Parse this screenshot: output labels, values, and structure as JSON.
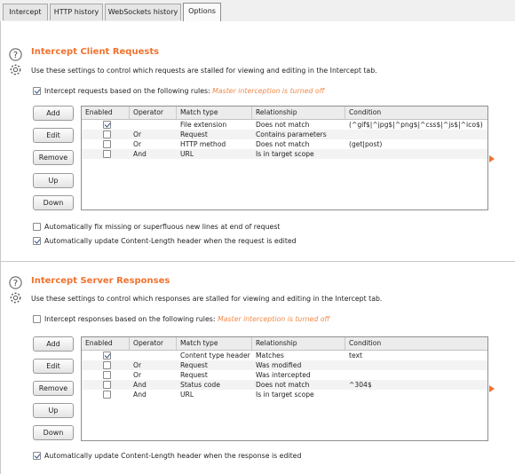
{
  "tabs": [
    {
      "label": "Intercept"
    },
    {
      "label": "HTTP history"
    },
    {
      "label": "WebSockets history"
    },
    {
      "label": "Options"
    }
  ],
  "client": {
    "title": "Intercept Client Requests",
    "description": "Use these settings to control which requests are stalled for viewing and editing in the Intercept tab.",
    "rules_checkbox_label": "Intercept requests based on the following rules:",
    "rules_checked": true,
    "warning": "Master interception is turned off",
    "buttons": {
      "add": "Add",
      "edit": "Edit",
      "remove": "Remove",
      "up": "Up",
      "down": "Down"
    },
    "columns": {
      "enabled": "Enabled",
      "operator": "Operator",
      "match_type": "Match type",
      "relationship": "Relationship",
      "condition": "Condition"
    },
    "rows": [
      {
        "enabled": true,
        "operator": "",
        "match_type": "File extension",
        "relationship": "Does not match",
        "condition": "(^gif$|^jpg$|^png$|^css$|^js$|^ico$)"
      },
      {
        "enabled": false,
        "operator": "Or",
        "match_type": "Request",
        "relationship": "Contains parameters",
        "condition": ""
      },
      {
        "enabled": false,
        "operator": "Or",
        "match_type": "HTTP method",
        "relationship": "Does not match",
        "condition": "(get|post)"
      },
      {
        "enabled": false,
        "operator": "And",
        "match_type": "URL",
        "relationship": "Is in target scope",
        "condition": ""
      }
    ],
    "opt_fix_newlines": "Automatically fix missing or superfluous new lines at end of request",
    "opt_fix_newlines_checked": false,
    "opt_update_length": "Automatically update Content-Length header when the request is edited",
    "opt_update_length_checked": true
  },
  "server": {
    "title": "Intercept Server Responses",
    "description": "Use these settings to control which responses are stalled for viewing and editing in the Intercept tab.",
    "rules_checkbox_label": "Intercept responses based on the following rules:",
    "rules_checked": false,
    "warning": "Master interception is turned off",
    "buttons": {
      "add": "Add",
      "edit": "Edit",
      "remove": "Remove",
      "up": "Up",
      "down": "Down"
    },
    "columns": {
      "enabled": "Enabled",
      "operator": "Operator",
      "match_type": "Match type",
      "relationship": "Relationship",
      "condition": "Condition"
    },
    "rows": [
      {
        "enabled": true,
        "operator": "",
        "match_type": "Content type header",
        "relationship": "Matches",
        "condition": "text"
      },
      {
        "enabled": false,
        "operator": "Or",
        "match_type": "Request",
        "relationship": "Was modified",
        "condition": ""
      },
      {
        "enabled": false,
        "operator": "Or",
        "match_type": "Request",
        "relationship": "Was intercepted",
        "condition": ""
      },
      {
        "enabled": false,
        "operator": "And",
        "match_type": "Status code",
        "relationship": "Does not match",
        "condition": "^304$"
      },
      {
        "enabled": false,
        "operator": "And",
        "match_type": "URL",
        "relationship": "Is in target scope",
        "condition": ""
      }
    ],
    "opt_update_length": "Automatically update Content-Length header when the response is edited",
    "opt_update_length_checked": true
  },
  "icons": {
    "help": "help-icon",
    "settings": "gear-icon",
    "expand": "expand-arrow-icon"
  },
  "colors": {
    "accent": "#f0722f",
    "warning": "#f08a4b"
  }
}
